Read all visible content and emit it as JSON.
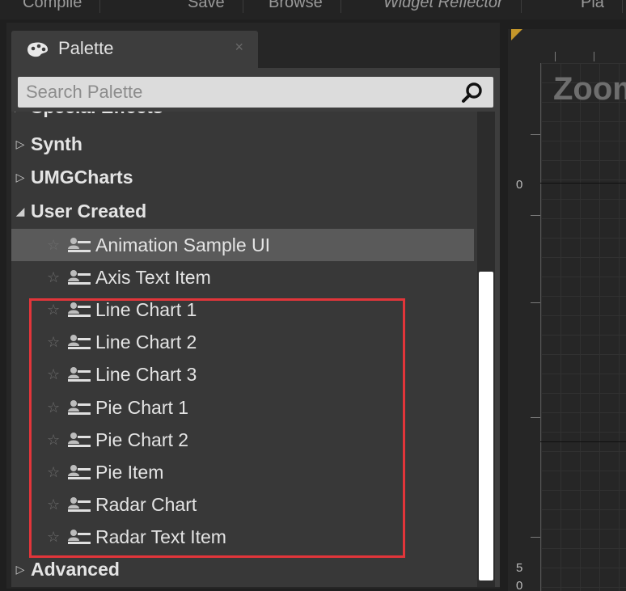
{
  "toolbar": {
    "items": [
      "Compile",
      "Save",
      "Browse",
      "Widget Reflector",
      "Pla"
    ]
  },
  "palette": {
    "tab_label": "Palette",
    "tab_close": "×",
    "search_placeholder": "Search Palette",
    "partial_category": "Special Effects",
    "categories_before": [
      {
        "label": "Synth",
        "expanded": false
      },
      {
        "label": "UMGCharts",
        "expanded": false
      }
    ],
    "user_created": {
      "label": "User Created",
      "expanded": true
    },
    "items": [
      {
        "label": "Animation Sample UI",
        "selected": true
      },
      {
        "label": "Axis Text Item",
        "selected": false
      },
      {
        "label": "Line Chart 1",
        "selected": false
      },
      {
        "label": "Line Chart 2",
        "selected": false
      },
      {
        "label": "Line Chart 3",
        "selected": false
      },
      {
        "label": "Pie Chart 1",
        "selected": false
      },
      {
        "label": "Pie Chart 2",
        "selected": false
      },
      {
        "label": "Pie Item",
        "selected": false
      },
      {
        "label": "Radar Chart",
        "selected": false
      },
      {
        "label": "Radar Text Item",
        "selected": false
      }
    ],
    "advanced": {
      "label": "Advanced",
      "expanded": false
    }
  },
  "designer": {
    "zoom_text": "Zoom",
    "ruler_zero": "0",
    "ruler_five": "5",
    "ruler_bottom": "0"
  },
  "colors": {
    "highlight": "#e2353a",
    "selected_row": "#5a5a5a",
    "corner_accent": "#c4962a"
  },
  "icons": {
    "tab": "palette-icon",
    "search": "search-icon",
    "favorite": "star-icon",
    "widget": "user-widget-icon",
    "collapsed": "triangle-right-icon",
    "expanded": "triangle-down-icon"
  }
}
